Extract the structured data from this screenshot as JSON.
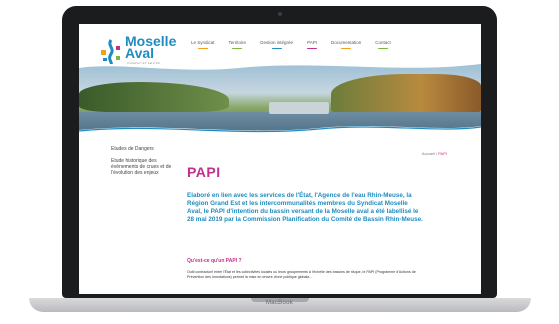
{
  "device": {
    "brand": "MacBook"
  },
  "site": {
    "logo": {
      "line1": "Moselle",
      "line2": "Aval",
      "tagline": "SYNDICAT MIXTE"
    },
    "nav": [
      {
        "label": "Le Syndicat",
        "color": "#f0a020"
      },
      {
        "label": "Territoire",
        "color": "#7ab83a"
      },
      {
        "label": "Gestion intégrée",
        "color": "#1f8cc1"
      },
      {
        "label": "PAPI",
        "color": "#c0308a"
      },
      {
        "label": "Documentation",
        "color": "#f0a020"
      },
      {
        "label": "Contact",
        "color": "#7ab83a"
      }
    ]
  },
  "sidebar": {
    "items": [
      "Etudes de Dangers",
      "Etude historique des événements de crues et de l'évolution des enjeux"
    ]
  },
  "breadcrumb": {
    "home": "Accueil",
    "separator": " / ",
    "current": "PAPI"
  },
  "main": {
    "title": "PAPI",
    "intro": "Elaboré en lien avec les services de l'État, l'Agence de l'eau Rhin-Meuse, la Région Grand Est et les intercommunalités membres du Syndicat Moselle Aval, le PAPI d'intention du bassin versant de la Moselle aval a été labellisé le 28 mai 2019 par la Commission Planification du Comité de Bassin Rhin-Meuse.",
    "faq_heading": "Qu'est-ce qu'un PAPI ?",
    "body": "Outil contractuel entre l'État et les collectivités locales ou leurs groupements à l'échelle des bassins de risque, le PAPI (Programme d'Actions de Prévention des Inondations) permet la mise en œuvre d'une politique globale..."
  },
  "colors": {
    "blue": "#1f8cc1",
    "magenta": "#c0308a",
    "orange": "#f0a020",
    "green": "#7ab83a"
  }
}
